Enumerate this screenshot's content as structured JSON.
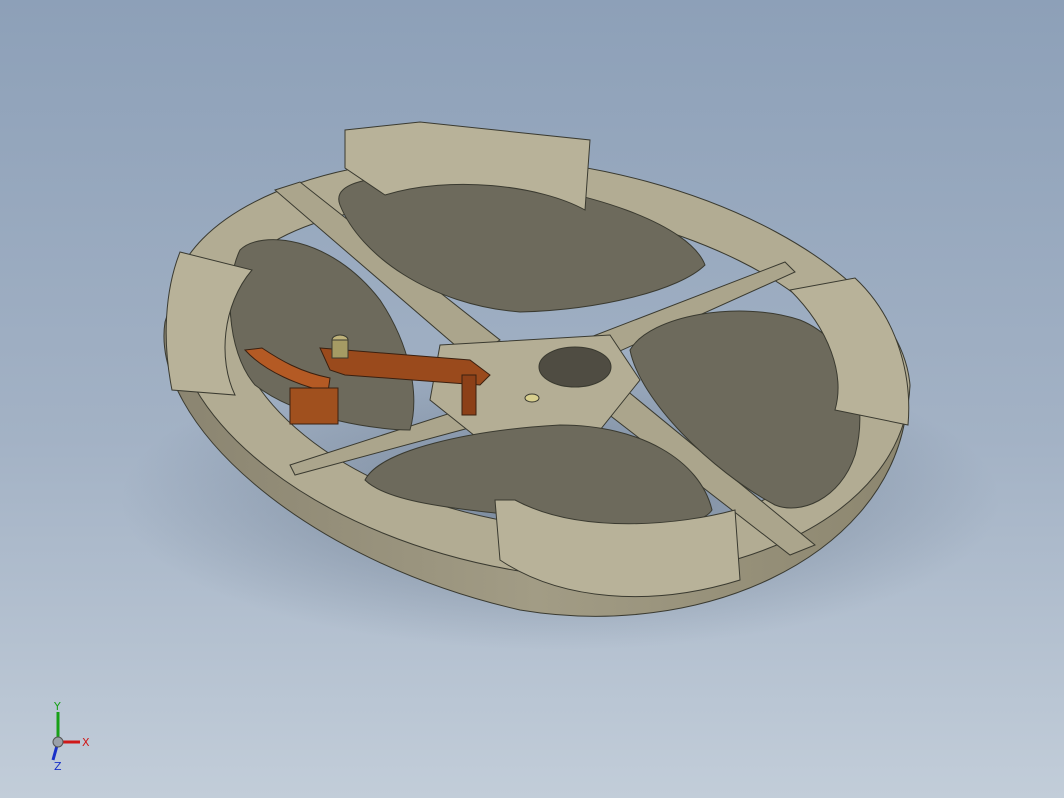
{
  "view": {
    "name": "isometric-3d-view"
  },
  "model": {
    "body_color": "#a8a28a",
    "body_top_color": "#b5af96",
    "body_side_color": "#8f8972",
    "shadow_color": "#6b7b90",
    "linkage_color": "#9a4a1c",
    "linkage_light_color": "#b45a24",
    "pin_color": "#bfb27a"
  },
  "triad": {
    "x_label": "X",
    "y_label": "Y",
    "z_label": "Z",
    "x_color": "#d01818",
    "y_color": "#18a018",
    "z_color": "#1830c8"
  }
}
